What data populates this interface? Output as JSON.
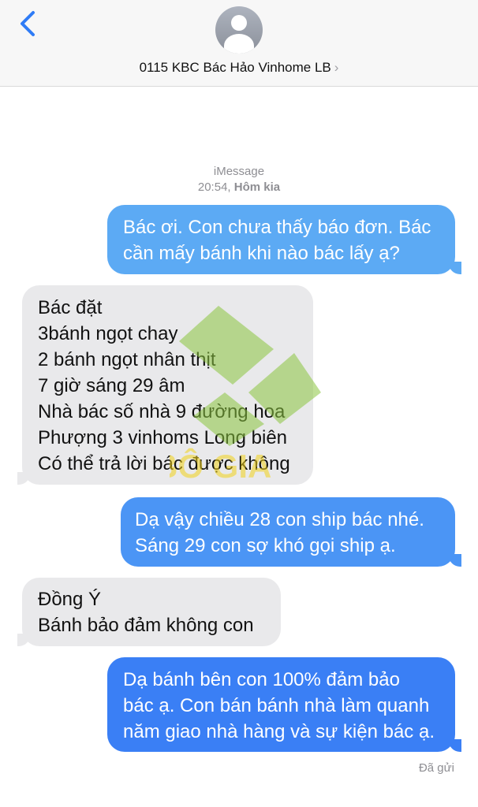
{
  "header": {
    "back_icon": "chevron-left-icon",
    "avatar_icon": "person-icon",
    "contact_name": "0115 KBC Bác Hảo Vinhome LB",
    "contact_chevron": "›"
  },
  "conversation": {
    "service": "iMessage",
    "time": "20:54,",
    "day": "Hôm kia",
    "messages": [
      {
        "direction": "outgoing",
        "text": "Bác ơi. Con chưa thấy báo đơn. Bác\ncần mấy bánh khi nào bác lấy ạ?"
      },
      {
        "direction": "incoming",
        "text": "Bác đặt\n3bánh ngọt chay\n2 bánh ngọt nhân thịt\n7 giờ sáng 29 âm\nNhà bác số nhà 9 đường hoa\nPhượng 3 vinhoms Long biên\nCó thể trả lời bác được không"
      },
      {
        "direction": "outgoing",
        "text": "Dạ vậy chiều 28 con ship bác nhé.\nSáng 29 con sợ khó gọi ship ạ."
      },
      {
        "direction": "incoming",
        "text": "Đồng Ý\nBánh bảo đảm không con"
      },
      {
        "direction": "outgoing",
        "text": "Dạ bánh bên con 100% đảm bảo\nbác ạ. Con bán bánh nhà làm quanh\nnăm giao nhà hàng và sự kiện bác ạ."
      }
    ],
    "status": "Đã gửi"
  },
  "watermark": {
    "text": "BÔ GIA",
    "color": "#8cc63f"
  },
  "colors": {
    "header_bg": "#f7f7f7",
    "accent": "#2f7cf6",
    "incoming_bubble": "#e9e9eb",
    "outgoing_top": "#5caaf4",
    "outgoing_mid": "#4b95f5",
    "outgoing_bottom": "#3a7ff5",
    "meta_text": "#8e8e93"
  }
}
